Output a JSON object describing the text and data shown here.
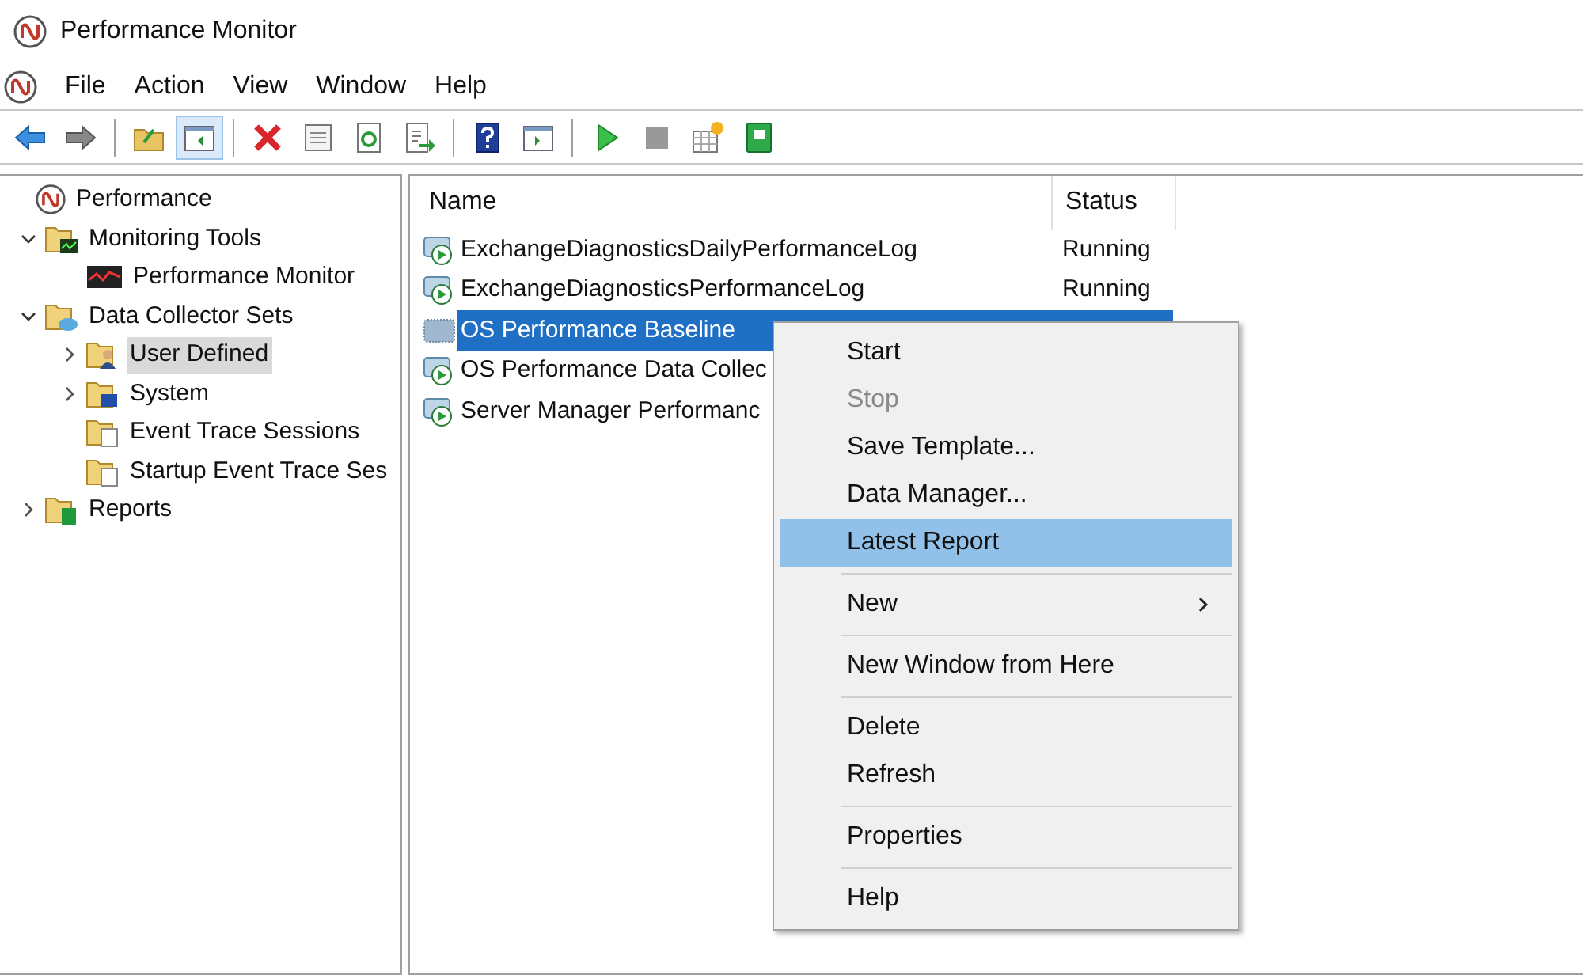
{
  "window": {
    "title": "Performance Monitor"
  },
  "menu_bar": [
    "File",
    "Action",
    "View",
    "Window",
    "Help"
  ],
  "toolbar": [
    {
      "kind": "back",
      "selected": false
    },
    {
      "kind": "forward",
      "selected": false
    },
    {
      "kind": "separator"
    },
    {
      "kind": "up-folder",
      "selected": false
    },
    {
      "kind": "show-tree",
      "selected": true
    },
    {
      "kind": "separator"
    },
    {
      "kind": "delete",
      "selected": false
    },
    {
      "kind": "properties",
      "selected": false
    },
    {
      "kind": "refresh",
      "selected": false
    },
    {
      "kind": "export",
      "selected": false
    },
    {
      "kind": "separator"
    },
    {
      "kind": "help",
      "selected": false
    },
    {
      "kind": "show-pane",
      "selected": false
    },
    {
      "kind": "separator"
    },
    {
      "kind": "start",
      "selected": false
    },
    {
      "kind": "stop",
      "selected": false
    },
    {
      "kind": "new",
      "selected": false
    },
    {
      "kind": "report",
      "selected": false
    }
  ],
  "tree": [
    {
      "label": "Performance",
      "kind": "root",
      "selected": false,
      "children": [
        {
          "label": "Monitoring Tools",
          "kind": "folder-chart",
          "selected": false,
          "expanded": true,
          "children": [
            {
              "label": "Performance Monitor",
              "kind": "monitor",
              "selected": false
            }
          ]
        },
        {
          "label": "Data Collector Sets",
          "kind": "folder-db",
          "selected": false,
          "expanded": true,
          "children": [
            {
              "label": "User Defined",
              "kind": "folder-user",
              "selected": true,
              "expanded": false
            },
            {
              "label": "System",
              "kind": "folder-pc",
              "selected": false,
              "expanded": false
            },
            {
              "label": "Event Trace Sessions",
              "kind": "folder-trace",
              "selected": false
            },
            {
              "label": "Startup Event Trace Ses",
              "kind": "folder-trace",
              "selected": false
            }
          ]
        },
        {
          "label": "Reports",
          "kind": "folder-report",
          "selected": false,
          "expanded": false
        }
      ]
    }
  ],
  "list": {
    "columns": [
      "Name",
      "Status"
    ],
    "rows": [
      {
        "name": "ExchangeDiagnosticsDailyPerformanceLog",
        "status": "Running",
        "kind": "collector",
        "selected": false
      },
      {
        "name": "ExchangeDiagnosticsPerformanceLog",
        "status": "Running",
        "kind": "collector",
        "selected": false
      },
      {
        "name": "OS Performance Baseline",
        "kind": "template",
        "selected": true
      },
      {
        "name": "OS Performance Data Collec",
        "kind": "collector",
        "selected": false
      },
      {
        "name": "Server Manager Performanc",
        "kind": "collector",
        "selected": false
      }
    ]
  },
  "context_menu": [
    {
      "kind": "item",
      "label": "Start",
      "disabled": false,
      "selected": false
    },
    {
      "kind": "item",
      "label": "Stop",
      "disabled": true,
      "selected": false
    },
    {
      "kind": "item",
      "label": "Save Template...",
      "disabled": false,
      "selected": false
    },
    {
      "kind": "item",
      "label": "Data Manager...",
      "disabled": false,
      "selected": false
    },
    {
      "kind": "item",
      "label": "Latest Report",
      "disabled": false,
      "selected": true
    },
    {
      "kind": "separator"
    },
    {
      "kind": "item",
      "label": "New",
      "disabled": false,
      "selected": false,
      "submenu": true
    },
    {
      "kind": "separator"
    },
    {
      "kind": "item",
      "label": "New Window from Here",
      "disabled": false,
      "selected": false
    },
    {
      "kind": "separator"
    },
    {
      "kind": "item",
      "label": "Delete",
      "disabled": false,
      "selected": false
    },
    {
      "kind": "item",
      "label": "Refresh",
      "disabled": false,
      "selected": false
    },
    {
      "kind": "separator"
    },
    {
      "kind": "item",
      "label": "Properties",
      "disabled": false,
      "selected": false
    },
    {
      "kind": "separator"
    },
    {
      "kind": "item",
      "label": "Help",
      "disabled": false,
      "selected": false
    }
  ]
}
